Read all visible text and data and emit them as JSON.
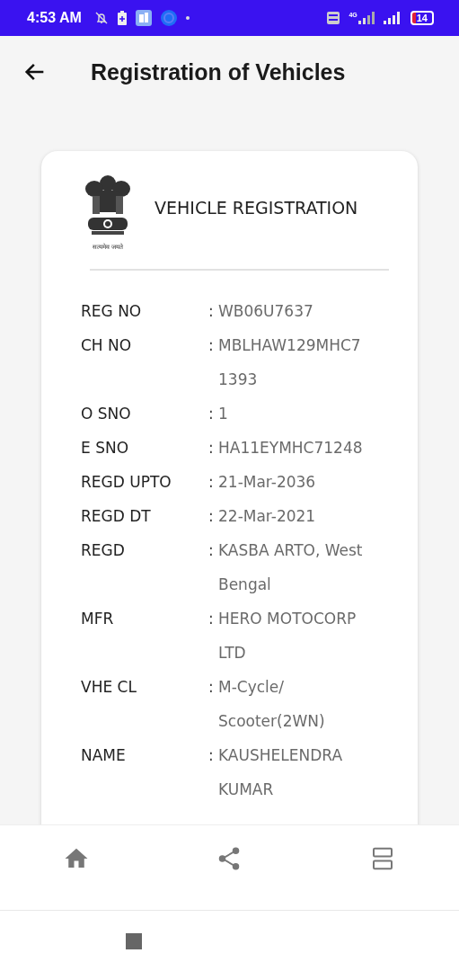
{
  "status_bar": {
    "time": "4:53 AM",
    "network": "4G",
    "battery": "14"
  },
  "app_bar": {
    "title": "Registration of Vehicles"
  },
  "card": {
    "title": "VEHICLE REGISTRATION",
    "motto": "सत्यमेव जयते",
    "rows": [
      {
        "label": "REG NO",
        "separator": ":",
        "lines": [
          "WB06U7637"
        ]
      },
      {
        "label": "CH NO",
        "separator": ":",
        "lines": [
          "MBLHAW129MHC7",
          "1393"
        ]
      },
      {
        "label": "O SNO",
        "separator": ":",
        "lines": [
          "1"
        ]
      },
      {
        "label": "E SNO",
        "separator": ":",
        "lines": [
          "HA11EYMHC71248"
        ]
      },
      {
        "label": "REGD UPTO",
        "separator": ":",
        "lines": [
          "21-Mar-2036"
        ]
      },
      {
        "label": "REGD DT",
        "separator": ":",
        "lines": [
          "22-Mar-2021"
        ]
      },
      {
        "label": "REGD",
        "separator": ":",
        "lines": [
          "KASBA ARTO, West",
          "Bengal"
        ]
      },
      {
        "label": "MFR",
        "separator": ":",
        "lines": [
          "HERO MOTOCORP",
          "LTD"
        ]
      },
      {
        "label": "VHE CL",
        "separator": ":",
        "lines": [
          "M-Cycle/",
          "Scooter(2WN)"
        ]
      },
      {
        "label": "NAME",
        "separator": ":",
        "lines": [
          "KAUSHELENDRA",
          "KUMAR"
        ]
      }
    ]
  },
  "bottom_nav": [
    {
      "kind": "home"
    },
    {
      "kind": "share"
    },
    {
      "kind": "list"
    }
  ]
}
